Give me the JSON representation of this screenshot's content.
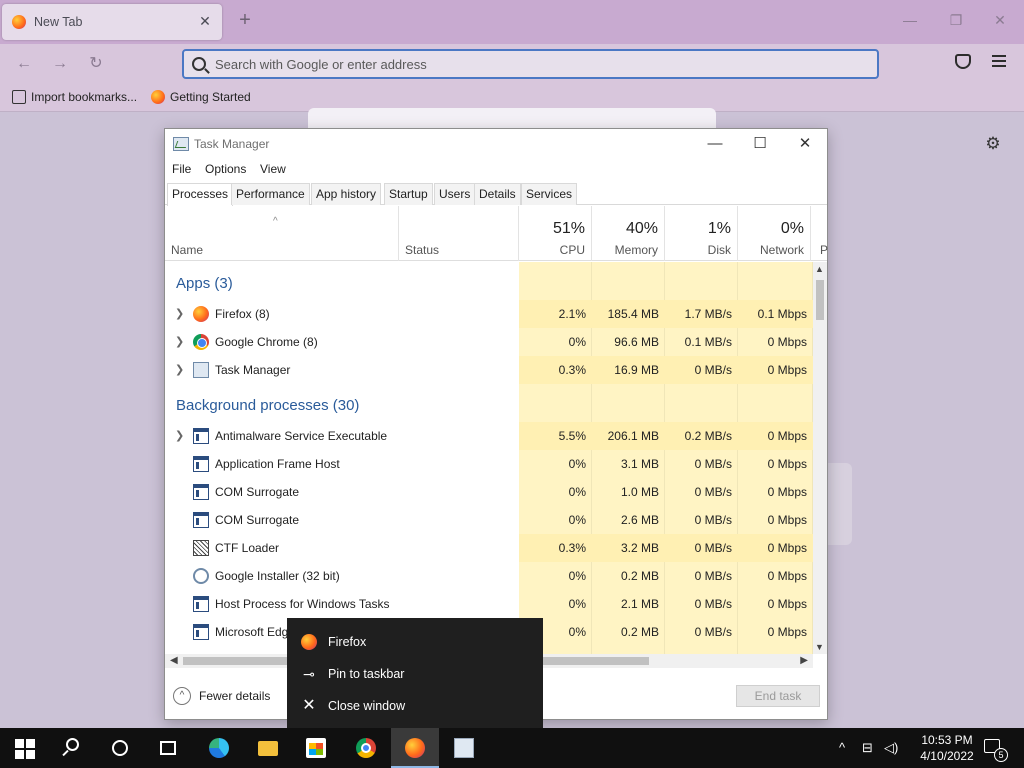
{
  "browser": {
    "tab_title": "New Tab",
    "tab_close": "✕",
    "new_tab": "+",
    "win_minimize": "—",
    "win_maximize": "❐",
    "win_close": "✕",
    "back": "←",
    "forward": "→",
    "reload": "↻",
    "url_placeholder": "Search with Google or enter address",
    "bookmarks": [
      "Import bookmarks...",
      "Getting Started"
    ],
    "settings_gear": "⚙",
    "icons": [
      "firefox-icon",
      "search-icon",
      "pocket-icon",
      "hamburger-menu-icon",
      "import-icon",
      "gear-icon"
    ]
  },
  "task_manager": {
    "title": "Task Manager",
    "controls": {
      "minimize": "—",
      "maximize": "☐",
      "close": "✕"
    },
    "menu": [
      "File",
      "Options",
      "View"
    ],
    "tabs": [
      "Processes",
      "Performance",
      "App history",
      "Startup",
      "Users",
      "Details",
      "Services"
    ],
    "active_tab": "Processes",
    "sort_indicator": "^",
    "columns": {
      "name": "Name",
      "status": "Status",
      "cpu": {
        "pct": "51%",
        "label": "CPU"
      },
      "memory": {
        "pct": "40%",
        "label": "Memory"
      },
      "disk": {
        "pct": "1%",
        "label": "Disk"
      },
      "network": {
        "pct": "0%",
        "label": "Network"
      },
      "power": "P"
    },
    "groups": {
      "apps": "Apps (3)",
      "background": "Background processes (30)"
    },
    "apps": [
      {
        "name": "Firefox (8)",
        "cpu": "2.1%",
        "memory": "185.4 MB",
        "disk": "1.7 MB/s",
        "network": "0.1 Mbps",
        "icon": "firefox-icon",
        "expandable": true
      },
      {
        "name": "Google Chrome (8)",
        "cpu": "0%",
        "memory": "96.6 MB",
        "disk": "0.1 MB/s",
        "network": "0 Mbps",
        "icon": "chrome-icon",
        "expandable": true
      },
      {
        "name": "Task Manager",
        "cpu": "0.3%",
        "memory": "16.9 MB",
        "disk": "0 MB/s",
        "network": "0 Mbps",
        "icon": "task-manager-icon",
        "expandable": true
      }
    ],
    "background": [
      {
        "name": "Antimalware Service Executable",
        "cpu": "5.5%",
        "memory": "206.1 MB",
        "disk": "0.2 MB/s",
        "network": "0 Mbps",
        "icon": "service-window-icon",
        "expandable": true
      },
      {
        "name": "Application Frame Host",
        "cpu": "0%",
        "memory": "3.1 MB",
        "disk": "0 MB/s",
        "network": "0 Mbps",
        "icon": "service-window-icon",
        "expandable": false
      },
      {
        "name": "COM Surrogate",
        "cpu": "0%",
        "memory": "1.0 MB",
        "disk": "0 MB/s",
        "network": "0 Mbps",
        "icon": "service-window-icon",
        "expandable": false
      },
      {
        "name": "COM Surrogate",
        "cpu": "0%",
        "memory": "2.6 MB",
        "disk": "0 MB/s",
        "network": "0 Mbps",
        "icon": "service-window-icon",
        "expandable": false
      },
      {
        "name": "CTF Loader",
        "cpu": "0.3%",
        "memory": "3.2 MB",
        "disk": "0 MB/s",
        "network": "0 Mbps",
        "icon": "ctf-loader-icon",
        "expandable": false
      },
      {
        "name": "Google Installer (32 bit)",
        "cpu": "0%",
        "memory": "0.2 MB",
        "disk": "0 MB/s",
        "network": "0 Mbps",
        "icon": "google-installer-icon",
        "expandable": false
      },
      {
        "name": "Host Process for Windows Tasks",
        "cpu": "0%",
        "memory": "2.1 MB",
        "disk": "0 MB/s",
        "network": "0 Mbps",
        "icon": "service-window-icon",
        "expandable": false
      },
      {
        "name": "Microsoft Edg",
        "cpu": "0%",
        "memory": "0.2 MB",
        "disk": "0 MB/s",
        "network": "0 Mbps",
        "icon": "service-window-icon",
        "expandable": false
      }
    ],
    "footer": {
      "fewer_details": "Fewer details",
      "end_task": "End task",
      "collapse_glyph": "^"
    }
  },
  "jumplist": {
    "items": [
      {
        "label": "Firefox",
        "icon": "firefox-icon",
        "glyph": ""
      },
      {
        "label": "Pin to taskbar",
        "icon": "pin-icon",
        "glyph": "⊸"
      },
      {
        "label": "Close window",
        "icon": "close-icon",
        "glyph": "✕"
      }
    ]
  },
  "taskbar": {
    "apps": [
      "start-icon",
      "search-icon",
      "cortana-icon",
      "task-view-icon",
      "edge-icon",
      "file-explorer-icon",
      "store-icon",
      "chrome-icon",
      "firefox-icon",
      "task-manager-icon"
    ],
    "active_app": "firefox-icon",
    "tray": {
      "chevron": "^",
      "network": "⊟",
      "volume": "◁)"
    },
    "time": "10:53 PM",
    "date": "4/10/2022",
    "notification_count": "5"
  }
}
